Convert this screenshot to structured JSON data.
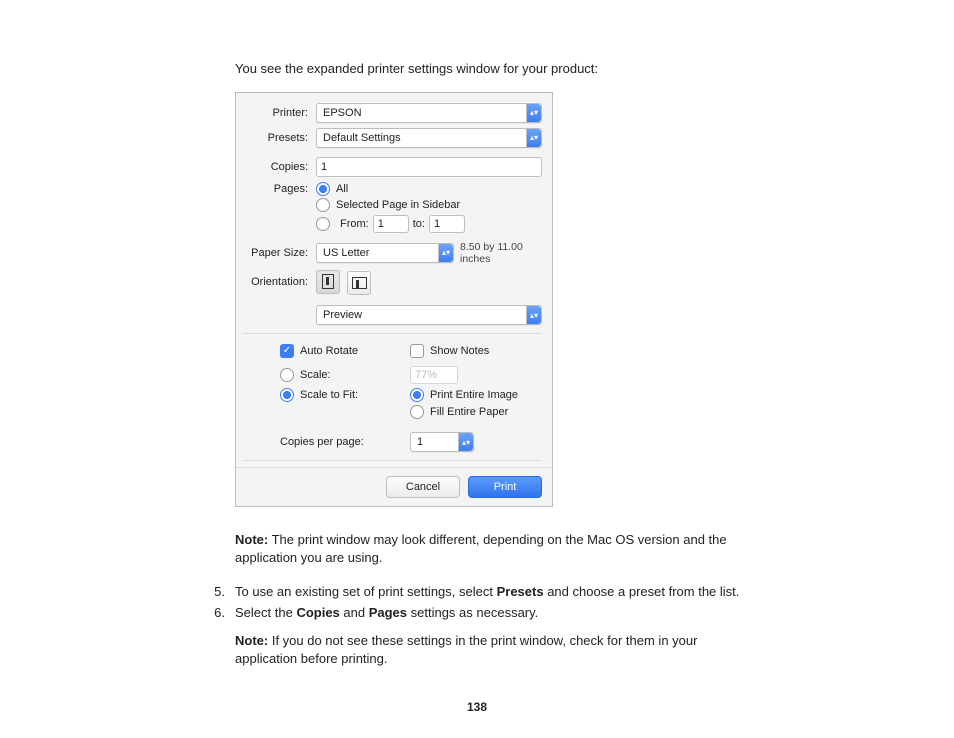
{
  "doc": {
    "intro": "You see the expanded printer settings window for your product:",
    "note1_label": "Note:",
    "note1_text": " The print window may look different, depending on the Mac OS version and the application you are using.",
    "step5_num": "5.",
    "step5_a": "To use an existing set of print settings, select ",
    "step5_b": "Presets",
    "step5_c": " and choose a preset from the list.",
    "step6_num": "6.",
    "step6_a": "Select the ",
    "step6_b": "Copies",
    "step6_c": " and ",
    "step6_d": "Pages",
    "step6_e": " settings as necessary.",
    "note2_label": "Note:",
    "note2_text": " If you do not see these settings in the print window, check for them in your application before printing.",
    "page_number": "138"
  },
  "dialog": {
    "printer_label": "Printer:",
    "printer_value": "EPSON",
    "presets_label": "Presets:",
    "presets_value": "Default Settings",
    "copies_label": "Copies:",
    "copies_value": "1",
    "pages_label": "Pages:",
    "pages_all": "All",
    "pages_selected": "Selected Page in Sidebar",
    "pages_from": "From:",
    "pages_from_value": "1",
    "pages_to": "to:",
    "pages_to_value": "1",
    "paper_size_label": "Paper Size:",
    "paper_size_value": "US Letter",
    "paper_size_hint": "8.50 by 11.00 inches",
    "orientation_label": "Orientation:",
    "section_dropdown": "Preview",
    "auto_rotate": "Auto Rotate",
    "show_notes": "Show Notes",
    "scale_label": "Scale:",
    "scale_value": "77%",
    "scale_to_fit": "Scale to Fit:",
    "print_entire": "Print Entire Image",
    "fill_entire": "Fill Entire Paper",
    "copies_per_page": "Copies per page:",
    "copies_per_page_value": "1",
    "cancel": "Cancel",
    "print": "Print"
  }
}
